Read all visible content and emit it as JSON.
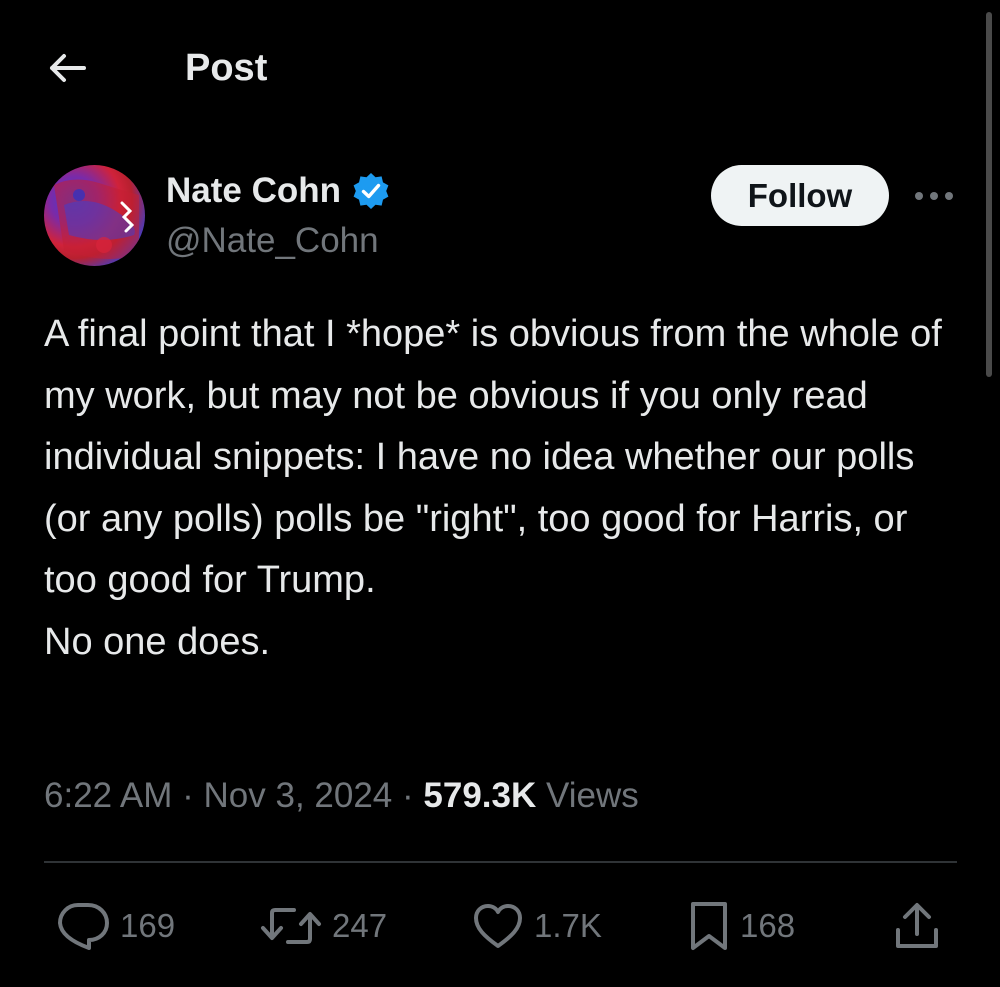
{
  "header": {
    "title": "Post",
    "back_icon": "arrow-left-icon"
  },
  "author": {
    "name": "Nate Cohn",
    "handle": "@Nate_Cohn",
    "verified": true,
    "verified_color": "#1d9bf0"
  },
  "follow_label": "Follow",
  "more_icon": "more-horizontal-icon",
  "tweet": {
    "text": "A final point that I *hope* is obvious from the whole of my work, but may not be obvious if you only read individual snippets: I have no idea whether our polls (or any polls) polls be \"right\", too good for Harris, or too good for Trump.\nNo one does."
  },
  "meta": {
    "time": "6:22 AM",
    "separator": " · ",
    "date": "Nov 3, 2024",
    "views_count": "579.3K",
    "views_label": " Views"
  },
  "actions": {
    "replies": "169",
    "reposts": "247",
    "likes": "1.7K",
    "bookmarks": "168"
  },
  "colors": {
    "background": "#000000",
    "text": "#e7e9ea",
    "secondary": "#71767b",
    "divider": "#2f3336",
    "follow_bg": "#eff3f4"
  }
}
